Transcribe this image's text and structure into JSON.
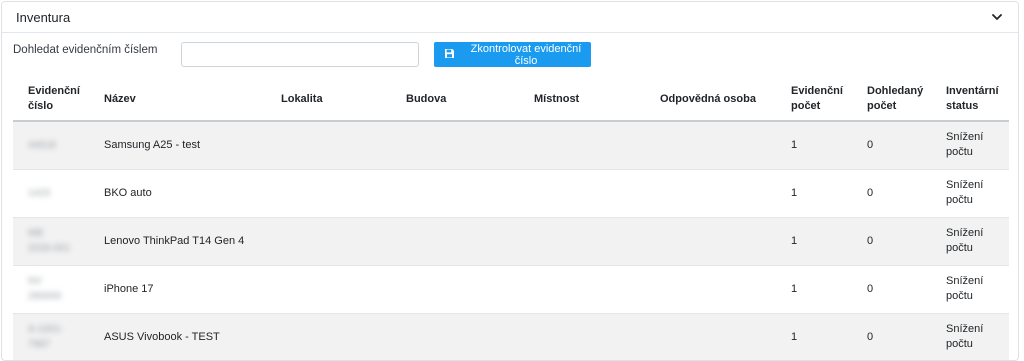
{
  "panel": {
    "title": "Inventura",
    "chevron_icon": "chevron-down-icon"
  },
  "search": {
    "label": "Dohledat evidenčním číslem",
    "value": "",
    "placeholder": "",
    "button_label": "Zkontrolovat evidenční číslo",
    "button_icon": "floppy-disk-icon",
    "button_color": "#1a9bf0"
  },
  "table": {
    "headers": {
      "evidencni_cislo": [
        "Evidenční",
        "číslo"
      ],
      "nazev": "Název",
      "lokalita": "Lokalita",
      "budova": "Budova",
      "mistnost": "Místnost",
      "odpovedna_osoba": "Odpovědná osoba",
      "evidencni_pocet": [
        "Evidenční",
        "počet"
      ],
      "dohledany_pocet": [
        "Dohledaný",
        "počet"
      ],
      "inventarni_status": [
        "Inventární",
        "status"
      ]
    },
    "rows": [
      {
        "cislo": [
          "44618"
        ],
        "nazev": "Samsung A25 - test",
        "lokalita": "",
        "budova": "",
        "mistnost": "",
        "osoba": "",
        "evidencni_pocet": "1",
        "dohledany_pocet": "0",
        "status": [
          "Snížení",
          "počtu"
        ]
      },
      {
        "cislo": [
          "1423"
        ],
        "nazev": "BKO auto",
        "lokalita": "",
        "budova": "",
        "mistnost": "",
        "osoba": "",
        "evidencni_pocet": "1",
        "dohledany_pocet": "0",
        "status": [
          "Snížení",
          "počtu"
        ]
      },
      {
        "cislo": [
          "MB",
          "2026-001"
        ],
        "nazev": "Lenovo ThinkPad T14 Gen 4",
        "lokalita": "",
        "budova": "",
        "mistnost": "",
        "osoba": "",
        "evidencni_pocet": "1",
        "dohledany_pocet": "0",
        "status": [
          "Snížení",
          "počtu"
        ]
      },
      {
        "cislo": [
          "NV",
          "290000"
        ],
        "nazev": "iPhone 17",
        "lokalita": "",
        "budova": "",
        "mistnost": "",
        "osoba": "",
        "evidencni_pocet": "1",
        "dohledany_pocet": "0",
        "status": [
          "Snížení",
          "počtu"
        ]
      },
      {
        "cislo": [
          "A-1001-",
          "7987"
        ],
        "nazev": "ASUS Vivobook - TEST",
        "lokalita": "",
        "budova": "",
        "mistnost": "",
        "osoba": "",
        "evidencni_pocet": "1",
        "dohledany_pocet": "0",
        "status": [
          "Snížení",
          "počtu"
        ]
      }
    ]
  }
}
